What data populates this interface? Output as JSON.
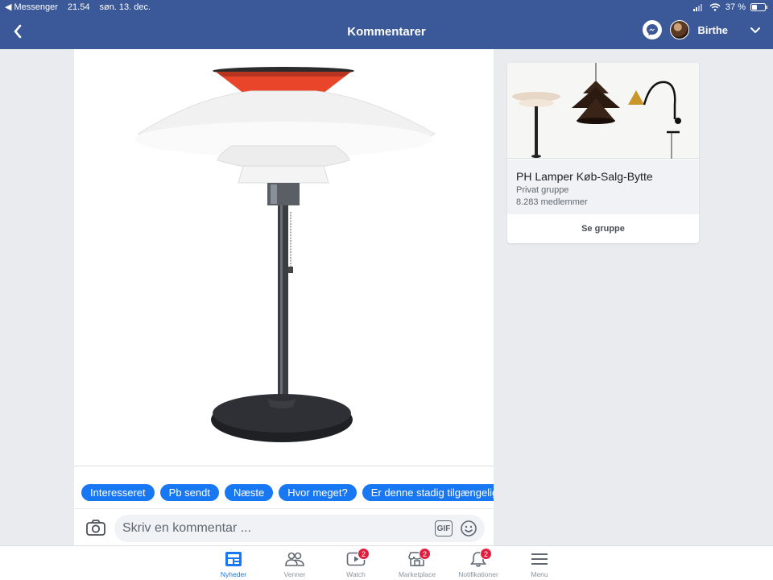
{
  "status_bar": {
    "back_app": "◀ Messenger",
    "time": "21.54",
    "date": "søn. 13. dec.",
    "battery": "37 %"
  },
  "nav": {
    "title": "Kommentarer",
    "profile_name": "Birthe"
  },
  "quick_replies": [
    "Interesseret",
    "Pb sendt",
    "Næste",
    "Hvor meget?",
    "Er denne stadig tilgængelig?"
  ],
  "comment": {
    "placeholder": "Skriv en kommentar ...",
    "gif_label": "GIF"
  },
  "group_card": {
    "name": "PH Lamper Køb-Salg-Bytte",
    "type": "Privat gruppe",
    "members": "8.283 medlemmer",
    "button_label": "Se gruppe"
  },
  "tabs": [
    {
      "label": "Nyheder",
      "icon": "news-feed-icon",
      "badge": null,
      "active": true
    },
    {
      "label": "Venner",
      "icon": "friends-icon",
      "badge": null,
      "active": false
    },
    {
      "label": "Watch",
      "icon": "watch-icon",
      "badge": "2",
      "active": false
    },
    {
      "label": "Marketplace",
      "icon": "marketplace-icon",
      "badge": "2",
      "active": false
    },
    {
      "label": "Notifikationer",
      "icon": "bell-icon",
      "badge": "2",
      "active": false
    },
    {
      "label": "Menu",
      "icon": "menu-icon",
      "badge": null,
      "active": false
    }
  ],
  "colors": {
    "nav_blue": "#3b5998",
    "chip_blue": "#1877f2",
    "badge_red": "#e41e3f"
  }
}
